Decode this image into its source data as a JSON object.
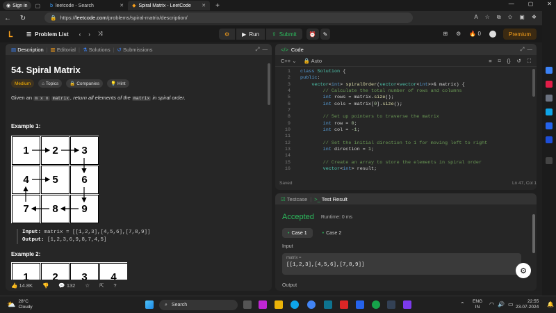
{
  "browser": {
    "signin_label": "Sign in",
    "tabs": [
      {
        "title": "leetcode - Search"
      },
      {
        "title": "Spiral Matrix - LeetCode"
      }
    ],
    "url_prefix": "https://",
    "url_host": "leetcode.com",
    "url_path": "/problems/spiral-matrix/description/"
  },
  "nav": {
    "problem_list": "Problem List",
    "run": "Run",
    "submit": "Submit",
    "premium": "Premium",
    "streak": "0"
  },
  "left_panel": {
    "tabs": [
      "Description",
      "Editorial",
      "Solutions",
      "Submissions"
    ],
    "title": "54. Spiral Matrix",
    "tags": [
      "Medium",
      "Topics",
      "Companies",
      "Hint"
    ],
    "desc_given": "Given an",
    "desc_code1": "m x n",
    "desc_code2": "matrix",
    "desc_rest": ", return all elements of the",
    "desc_code3": "matrix",
    "desc_end": "in spiral order.",
    "example1": "Example 1:",
    "grid1": [
      "1",
      "2",
      "3",
      "4",
      "5",
      "6",
      "7",
      "8",
      "9"
    ],
    "input_label": "Input:",
    "input_value": "matrix = [[1,2,3],[4,5,6],[7,8,9]]",
    "output_label": "Output:",
    "output_value": "[1,2,3,6,9,8,7,4,5]",
    "example2": "Example 2:",
    "grid2": [
      "1",
      "2",
      "3",
      "4"
    ],
    "likes": "14.8K",
    "comments": "132"
  },
  "code_panel": {
    "title": "Code",
    "lang": "C++",
    "mode": "Auto",
    "saved": "Saved",
    "cursor": "Ln 47, Col 1",
    "lines": [
      {
        "n": "1",
        "text": "class Solution {"
      },
      {
        "n": "2",
        "text": "public:"
      },
      {
        "n": "3",
        "text": "    vector<int> spiralOrder(vector<vector<int>>& matrix) {"
      },
      {
        "n": "4",
        "text": "        // Calculate the total number of rows and columns"
      },
      {
        "n": "5",
        "text": "        int rows = matrix.size();"
      },
      {
        "n": "6",
        "text": "        int cols = matrix[0].size();"
      },
      {
        "n": "7",
        "text": ""
      },
      {
        "n": "8",
        "text": "        // Set up pointers to traverse the matrix"
      },
      {
        "n": "9",
        "text": "        int row = 0;"
      },
      {
        "n": "10",
        "text": "        int col = -1;"
      },
      {
        "n": "11",
        "text": ""
      },
      {
        "n": "12",
        "text": "        // Set the initial direction to 1 for moving left to right"
      },
      {
        "n": "13",
        "text": "        int direction = 1;"
      },
      {
        "n": "14",
        "text": ""
      },
      {
        "n": "15",
        "text": "        // Create an array to store the elements in spiral order"
      },
      {
        "n": "16",
        "text": "        vector<int> result;"
      }
    ]
  },
  "test_panel": {
    "tab_testcase": "Testcase",
    "tab_result": "Test Result",
    "status": "Accepted",
    "runtime": "Runtime: 0 ms",
    "case1": "Case 1",
    "case2": "Case 2",
    "input_label": "Input",
    "var_name": "matrix =",
    "var_value": "[[1,2,3],[4,5,6],[7,8,9]]",
    "output_label": "Output"
  },
  "taskbar": {
    "temp": "28°C",
    "weather": "Cloudy",
    "search": "Search",
    "lang1": "ENG",
    "lang2": "IN",
    "time": "22:55",
    "date": "23-07-2024"
  },
  "colors": {
    "accepted": "#2cbb5d",
    "medium": "#ffb700",
    "premium": "#f8a01b"
  }
}
